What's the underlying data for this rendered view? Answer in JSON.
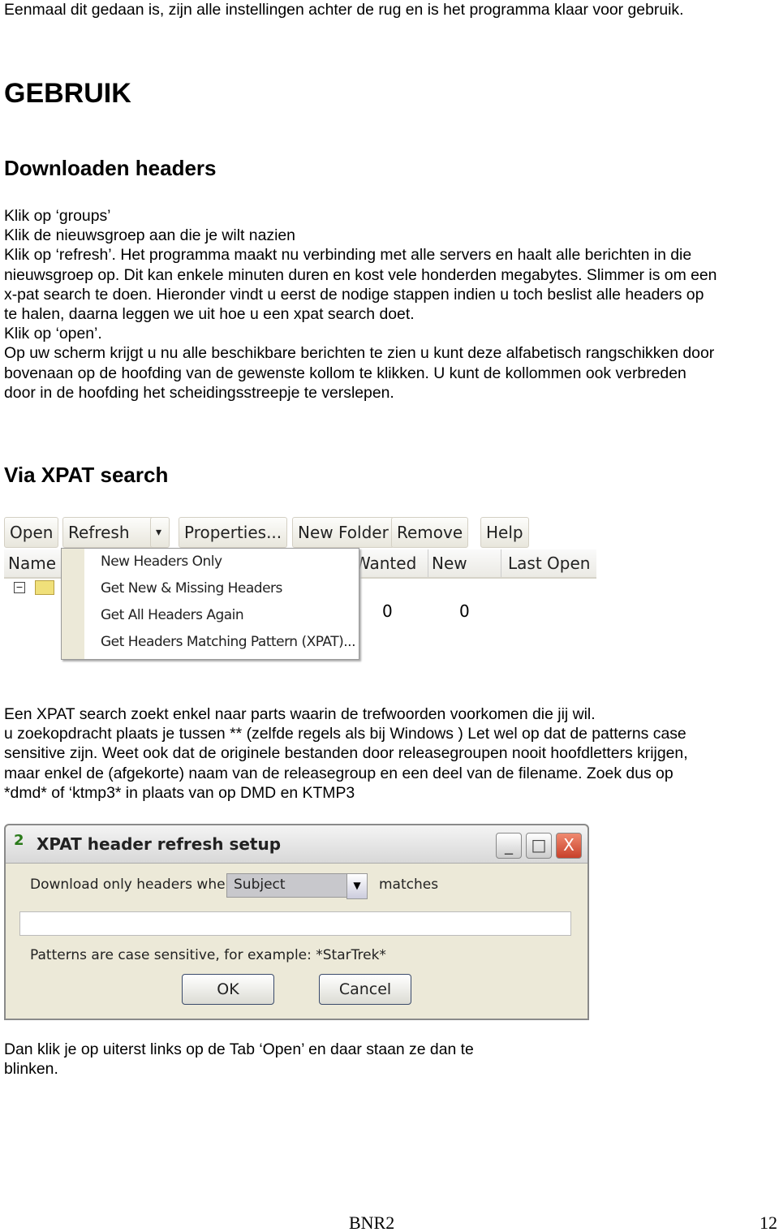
{
  "intro": "Eenmaal dit gedaan is, zijn alle instellingen achter de rug en is het programma klaar voor gebruik.",
  "heading": "GEBRUIK",
  "section1": {
    "title": "Downloaden headers",
    "lines": [
      "Klik op ‘groups’",
      "Klik de nieuwsgroep aan die je wilt nazien",
      "Klik op ‘refresh’. Het programma maakt nu verbinding met alle servers en haalt alle berichten in die",
      "nieuwsgroep op. Dit kan enkele minuten duren en kost vele honderden megabytes. Slimmer is om een",
      "x-pat search te doen. Hieronder vindt u eerst de nodige stappen indien u toch beslist alle headers op",
      "te halen, daarna leggen we uit hoe u een xpat search doet.",
      "Klik op ‘open’.",
      "Op uw scherm krijgt u nu alle beschikbare berichten te zien u kunt deze alfabetisch rangschikken door",
      "bovenaan op de hoofding van de gewenste kollom te klikken. U kunt de kollommen ook verbreden",
      "door in de hoofding het scheidingsstreepje te verslepen."
    ]
  },
  "section2": {
    "title": "Via XPAT search",
    "lines": [
      "Een XPAT search zoekt enkel naar parts waarin de trefwoorden voorkomen die jij wil.",
      "u zoekopdracht plaats je tussen ** (zelfde regels als bij Windows ) Let wel op dat de patterns case",
      "sensitive zijn. Weet ook dat de originele bestanden door releasegroupen nooit hoofdletters krijgen,",
      "maar enkel de (afgekorte) naam van de releasegroup en een deel van de filename. Zoek dus op",
      "*dmd* of ‘ktmp3* in plaats van op DMD en KTMP3"
    ],
    "outro": [
      "Dan klik je op uiterst links op de Tab ‘Open’ en daar staan ze dan te",
      "blinken."
    ]
  },
  "screenshot1": {
    "toolbar": [
      "Open",
      "Refresh",
      "▾",
      "Properties...",
      "New Folder",
      "Remove",
      "Help"
    ],
    "columns": [
      "Name",
      "Wanted",
      "New",
      "Last Open"
    ],
    "menu": [
      "New Headers Only",
      "Get New & Missing Headers",
      "Get All Headers Again",
      "Get Headers Matching Pattern (XPAT)..."
    ],
    "values": [
      "0",
      "0"
    ]
  },
  "dialog": {
    "title": "XPAT header refresh setup",
    "label": "Download only headers where",
    "select": "Subject",
    "matches": "matches",
    "pattern": "",
    "hint": "Patterns are case sensitive, for example: *StarTrek*",
    "ok": "OK",
    "cancel": "Cancel",
    "minimize": "_",
    "maximize": "□",
    "close": "X"
  },
  "footer": {
    "center": "BNR2",
    "page": "12"
  }
}
